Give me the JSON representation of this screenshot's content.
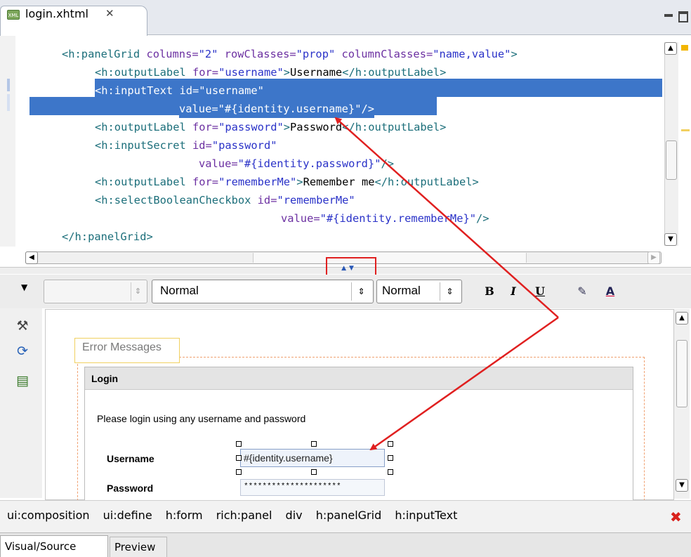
{
  "editor_tab": {
    "title": "login.xhtml",
    "icon": "xhtml-file-icon",
    "close_icon": "close-icon"
  },
  "source": {
    "lines": [
      [
        [
          "tag",
          "<h:panelGrid "
        ],
        [
          "attr",
          "columns="
        ],
        [
          "str",
          "\"2\""
        ],
        [
          "attr",
          " rowClasses="
        ],
        [
          "str",
          "\"prop\""
        ],
        [
          "attr",
          " columnClasses="
        ],
        [
          "str",
          "\"name,value\""
        ],
        [
          "tag",
          ">"
        ]
      ],
      [
        [
          "tag",
          "<h:outputLabel "
        ],
        [
          "attr",
          "for="
        ],
        [
          "str",
          "\"username\""
        ],
        [
          "tag",
          ">"
        ],
        [
          "txt",
          "Username"
        ],
        [
          "tag",
          "</h:outputLabel>"
        ]
      ],
      [
        [
          "tag",
          "<h:inputText "
        ],
        [
          "attr",
          "id="
        ],
        [
          "str",
          "\"username\""
        ]
      ],
      [
        [
          "attr",
          "value="
        ],
        [
          "str",
          "\"#{identity.username}\""
        ],
        [
          "tag",
          "/>"
        ]
      ],
      [
        [
          "tag",
          "<h:outputLabel "
        ],
        [
          "attr",
          "for="
        ],
        [
          "str",
          "\"password\""
        ],
        [
          "tag",
          ">"
        ],
        [
          "txt",
          "Password"
        ],
        [
          "tag",
          "</h:outputLabel>"
        ]
      ],
      [
        [
          "tag",
          "<h:inputSecret "
        ],
        [
          "attr",
          "id="
        ],
        [
          "str",
          "\"password\""
        ]
      ],
      [
        [
          "attr",
          "value="
        ],
        [
          "str",
          "\"#{identity.password}\""
        ],
        [
          "tag",
          "/>"
        ]
      ],
      [
        [
          "tag",
          "<h:outputLabel "
        ],
        [
          "attr",
          "for="
        ],
        [
          "str",
          "\"rememberMe\""
        ],
        [
          "tag",
          ">"
        ],
        [
          "txt",
          "Remember me"
        ],
        [
          "tag",
          "</h:outputLabel>"
        ]
      ],
      [
        [
          "tag",
          "<h:selectBooleanCheckbox "
        ],
        [
          "attr",
          "id="
        ],
        [
          "str",
          "\"rememberMe\""
        ]
      ],
      [
        [
          "attr",
          "value="
        ],
        [
          "str",
          "\"#{identity.rememberMe}\""
        ],
        [
          "tag",
          "/>"
        ]
      ],
      [
        [
          "tag",
          "</h:panelGrid>"
        ]
      ]
    ]
  },
  "toolbar": {
    "style_combo": "",
    "format_combo": "Normal",
    "size_combo": "Normal",
    "bold_label": "B",
    "italic_label": "I",
    "underline_label": "U"
  },
  "visual": {
    "error_messages_label": "Error Messages",
    "panel_title": "Login",
    "description": "Please login using any username and password",
    "username_label": "Username",
    "username_value": "#{identity.username}",
    "password_label": "Password",
    "password_value": "*********************"
  },
  "breadcrumbs": [
    "ui:composition",
    "ui:define",
    "h:form",
    "rich:panel",
    "div",
    "h:panelGrid",
    "h:inputText"
  ],
  "bottom_tabs": {
    "visual_source": "Visual/Source",
    "preview": "Preview"
  },
  "colors": {
    "selection": "#3d76c9",
    "annotation": "#e02020",
    "tag": "#1b6e7a",
    "attribute": "#6b2fa1",
    "string": "#2a32c8"
  }
}
